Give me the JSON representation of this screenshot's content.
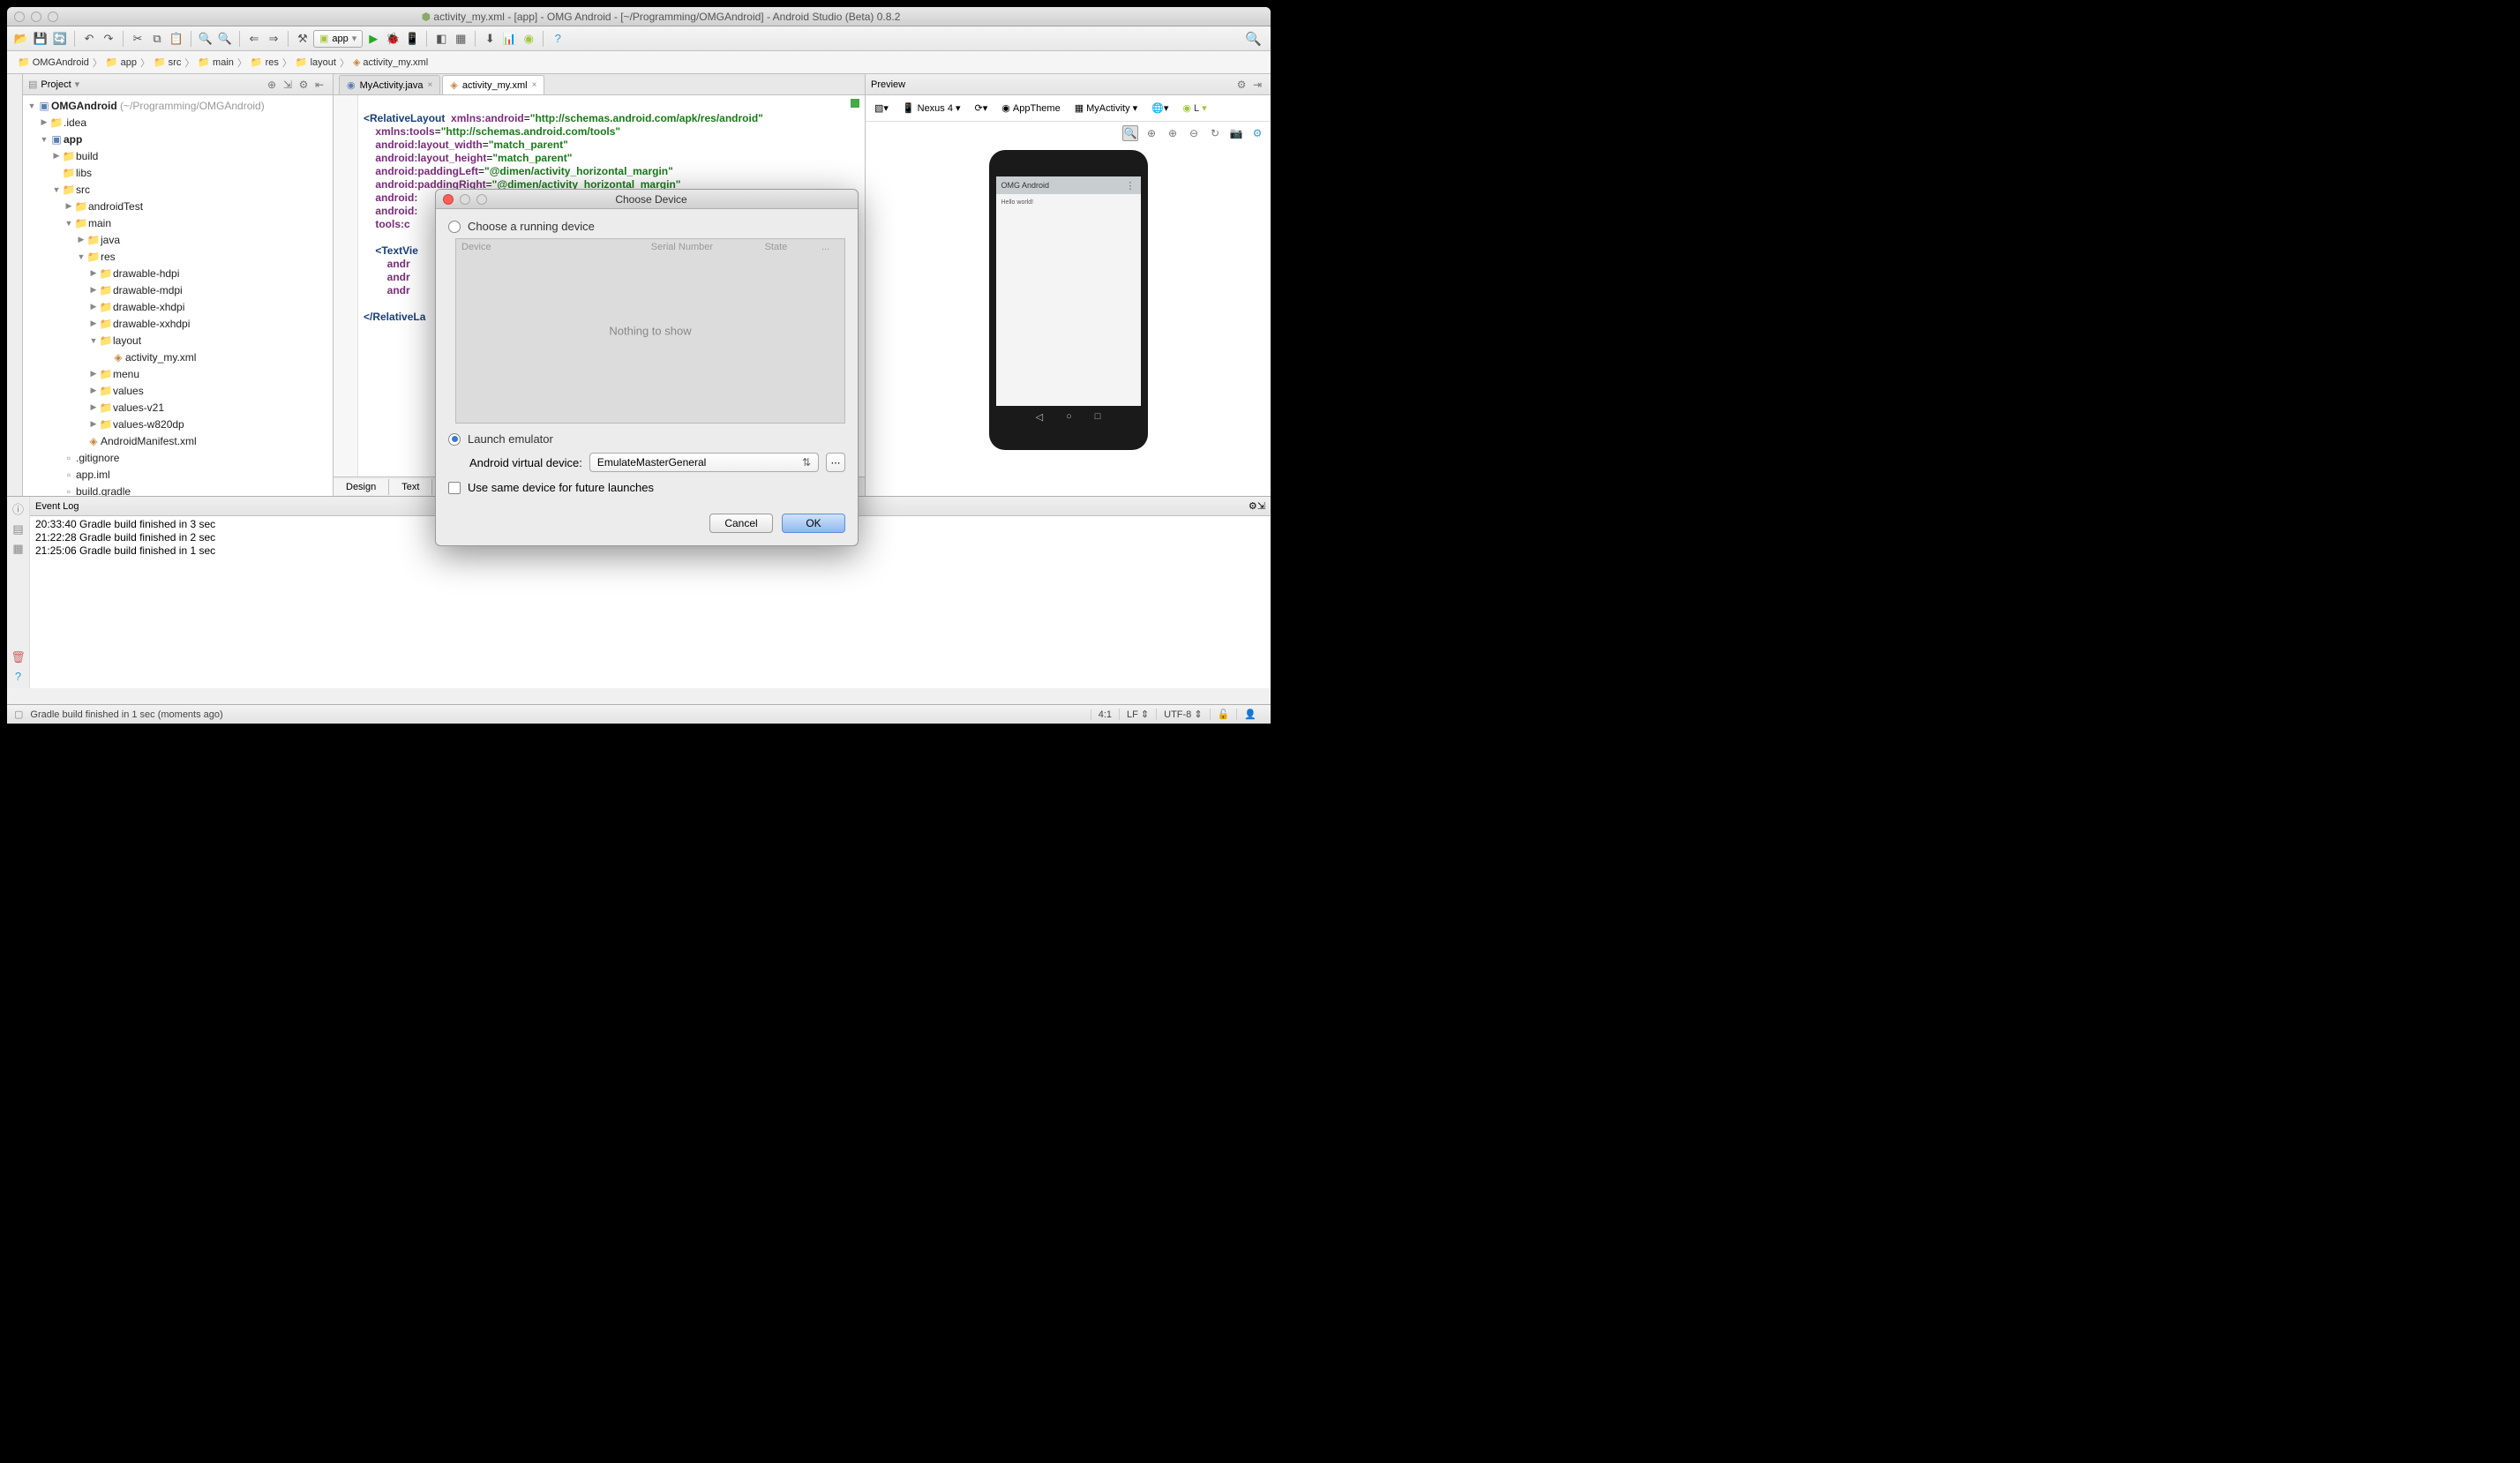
{
  "window": {
    "title": "activity_my.xml - [app] - OMG Android - [~/Programming/OMGAndroid] - Android Studio (Beta) 0.8.2"
  },
  "toolbar": {
    "run_config": "app"
  },
  "breadcrumbs": [
    "OMGAndroid",
    "app",
    "src",
    "main",
    "res",
    "layout",
    "activity_my.xml"
  ],
  "project_panel": {
    "title": "Project",
    "root": "OMGAndroid",
    "root_path": "(~/Programming/OMGAndroid)",
    "items": {
      "idea": ".idea",
      "app": "app",
      "build": "build",
      "libs": "libs",
      "src": "src",
      "androidTest": "androidTest",
      "main": "main",
      "java": "java",
      "res": "res",
      "drawable_hdpi": "drawable-hdpi",
      "drawable_mdpi": "drawable-mdpi",
      "drawable_xhdpi": "drawable-xhdpi",
      "drawable_xxhdpi": "drawable-xxhdpi",
      "layout": "layout",
      "activity_my": "activity_my.xml",
      "menu": "menu",
      "values": "values",
      "values_v21": "values-v21",
      "values_w820dp": "values-w820dp",
      "manifest": "AndroidManifest.xml",
      "gitignore": ".gitignore",
      "app_iml": "app.iml",
      "build_gradle": "build.gradle"
    }
  },
  "editor": {
    "tabs": [
      {
        "label": "MyActivity.java",
        "active": false
      },
      {
        "label": "activity_my.xml",
        "active": true
      }
    ],
    "code": {
      "l1a": "<",
      "l1b": "RelativeLayout",
      "l1c": " xmlns:android",
      "l1d": "=",
      "l1e": "\"http://schemas.android.com/apk/res/android\"",
      "l2a": "xmlns:tools",
      "l2b": "=",
      "l2c": "\"http://schemas.android.com/tools\"",
      "l3a": "android:layout_width",
      "l3b": "=",
      "l3c": "\"match_parent\"",
      "l4a": "android:layout_height",
      "l4b": "=",
      "l4c": "\"match_parent\"",
      "l5a": "android:paddingLeft",
      "l5b": "=",
      "l5c": "\"@dimen/activity_horizontal_margin\"",
      "l6a": "android:paddingRight",
      "l6b": "=",
      "l6c": "\"@dimen/activity_horizontal_margin\"",
      "l7a": "android:",
      "l8a": "android:",
      "l9a": "tools:c",
      "l11a": "<",
      "l11b": "TextVie",
      "l12a": "andr",
      "l13a": "andr",
      "l14a": "andr",
      "l16a": "</",
      "l16b": "RelativeLa"
    },
    "bottom_tabs": [
      "Design",
      "Text"
    ]
  },
  "preview": {
    "header": "Preview",
    "device": "Nexus 4",
    "theme": "AppTheme",
    "activity": "MyActivity",
    "lang": "L",
    "phone_title": "OMG Android",
    "phone_text": "Hello world!"
  },
  "dialog": {
    "title": "Choose Device",
    "opt_running": "Choose a running device",
    "th_device": "Device",
    "th_serial": "Serial Number",
    "th_state": "State",
    "th_more": "...",
    "nothing": "Nothing to show",
    "opt_launch": "Launch emulator",
    "avd_label": "Android virtual device:",
    "avd_value": "EmulateMasterGeneral",
    "checkbox_label": "Use same device for future launches",
    "cancel": "Cancel",
    "ok": "OK"
  },
  "event_log": {
    "title": "Event Log",
    "lines": [
      "20:33:40 Gradle build finished in 3 sec",
      "21:22:28 Gradle build finished in 2 sec",
      "21:25:06 Gradle build finished in 1 sec"
    ]
  },
  "statusbar": {
    "msg": "Gradle build finished in 1 sec (moments ago)",
    "pos": "4:1",
    "lf": "LF",
    "enc": "UTF-8"
  }
}
